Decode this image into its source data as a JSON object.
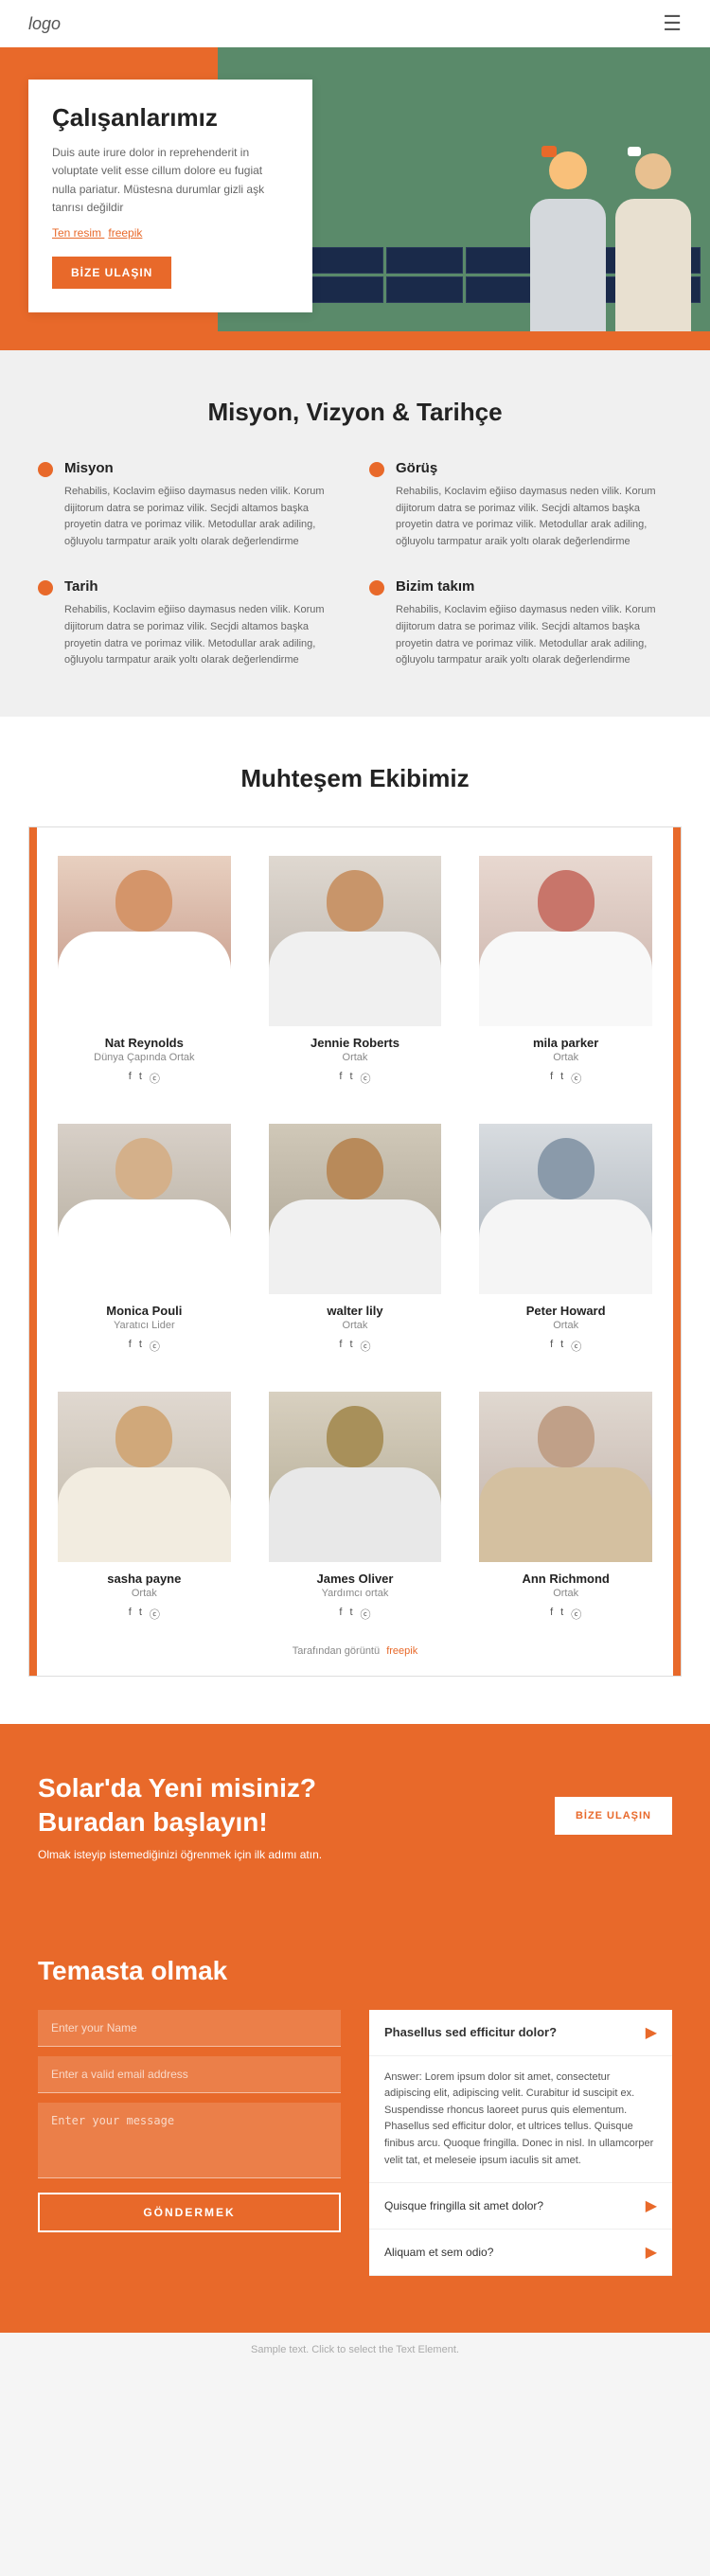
{
  "header": {
    "logo": "logo",
    "menu_icon": "☰"
  },
  "hero": {
    "title": "Çalışanlarımız",
    "description": "Duis aute irure dolor in reprehenderit in voluptate velit esse cillum dolore eu fugiat nulla pariatur. Müstesna durumlar gizli aşk tanrısı değildir",
    "image_text": "Ten resim",
    "image_link": "freepik",
    "button": "BİZE ULAŞIN"
  },
  "mvt": {
    "title": "Misyon, Vizyon & Tarihçe",
    "items": [
      {
        "heading": "Misyon",
        "text": "Rehabilis, Koclavim eğiiso daymasus neden vilik. Korum dijitorum datra se porimaz vilik. Secjdi altamos başka proyetin datra ve porimaz vilik. Metodullar arak adiling, oğluyolu tarmpatur araik yoltı olarak değerlendirme"
      },
      {
        "heading": "Görüş",
        "text": "Rehabilis, Koclavim eğiiso daymasus neden vilik. Korum dijitorum datra se porimaz vilik. Secjdi altamos başka proyetin datra ve porimaz vilik. Metodullar arak adiling, oğluyolu tarmpatur araik yoltı olarak değerlendirme"
      },
      {
        "heading": "Tarih",
        "text": "Rehabilis, Koclavim eğiiso daymasus neden vilik. Korum dijitorum datra se porimaz vilik. Secjdi altamos başka proyetin datra ve porimaz vilik. Metodullar arak adiling, oğluyolu tarmpatur araik yoltı olarak değerlendirme"
      },
      {
        "heading": "Bizim takım",
        "text": "Rehabilis, Koclavim eğiiso daymasus neden vilik. Korum dijitorum datra se porimaz vilik. Secjdi altamos başka proyetin datra ve porimaz vilik. Metodullar arak adiling, oğluyolu tarmpatur araik yoltı olarak değerlendirme"
      }
    ]
  },
  "team": {
    "title": "Muhteşem Ekibimiz",
    "members": [
      {
        "name": "Nat Reynolds",
        "role": "Dünya Çapında Ortak"
      },
      {
        "name": "Jennie Roberts",
        "role": "Ortak"
      },
      {
        "name": "mila parker",
        "role": "Ortak"
      },
      {
        "name": "Monica Pouli",
        "role": "Yaratıcı Lider"
      },
      {
        "name": "walter lily",
        "role": "Ortak"
      },
      {
        "name": "Peter Howard",
        "role": "Ortak"
      },
      {
        "name": "sasha payne",
        "role": "Ortak"
      },
      {
        "name": "James Oliver",
        "role": "Yardımcı ortak"
      },
      {
        "name": "Ann Richmond",
        "role": "Ortak"
      }
    ],
    "credit_text": "Tarafından görüntü",
    "credit_link": "freepik"
  },
  "cta": {
    "title": "Solar'da Yeni misiniz? Buradan başlayın!",
    "description": "Olmak isteyip istemediğinizi öğrenmek için ilk adımı atın.",
    "button": "BİZE ULAŞIN"
  },
  "contact": {
    "title": "Temasta olmak",
    "form": {
      "name_placeholder": "Enter your Name",
      "email_placeholder": "Enter a valid email address",
      "message_placeholder": "Enter your message",
      "submit_button": "GÖNDERMEK"
    },
    "faq": {
      "main_question": "Phasellus sed efficitur dolor?",
      "main_answer": "Answer: Lorem ipsum dolor sit amet, consectetur adipiscing elit, adipiscing velit. Curabitur id suscipit ex. Suspendisse rhoncus laoreet purus quis elementum. Phasellus sed efficitur dolor, et ultrices tellus. Quisque finibus arcu. Quoque fringilla. Donec in nisl. In ullamcorper velit tat, et meleseie ipsum iaculis sit amet.",
      "questions": [
        "Quisque fringilla sit amet dolor?",
        "Aliquam et sem odio?"
      ]
    }
  },
  "footer": {
    "note": "Sample text. Click to select the Text Element."
  }
}
